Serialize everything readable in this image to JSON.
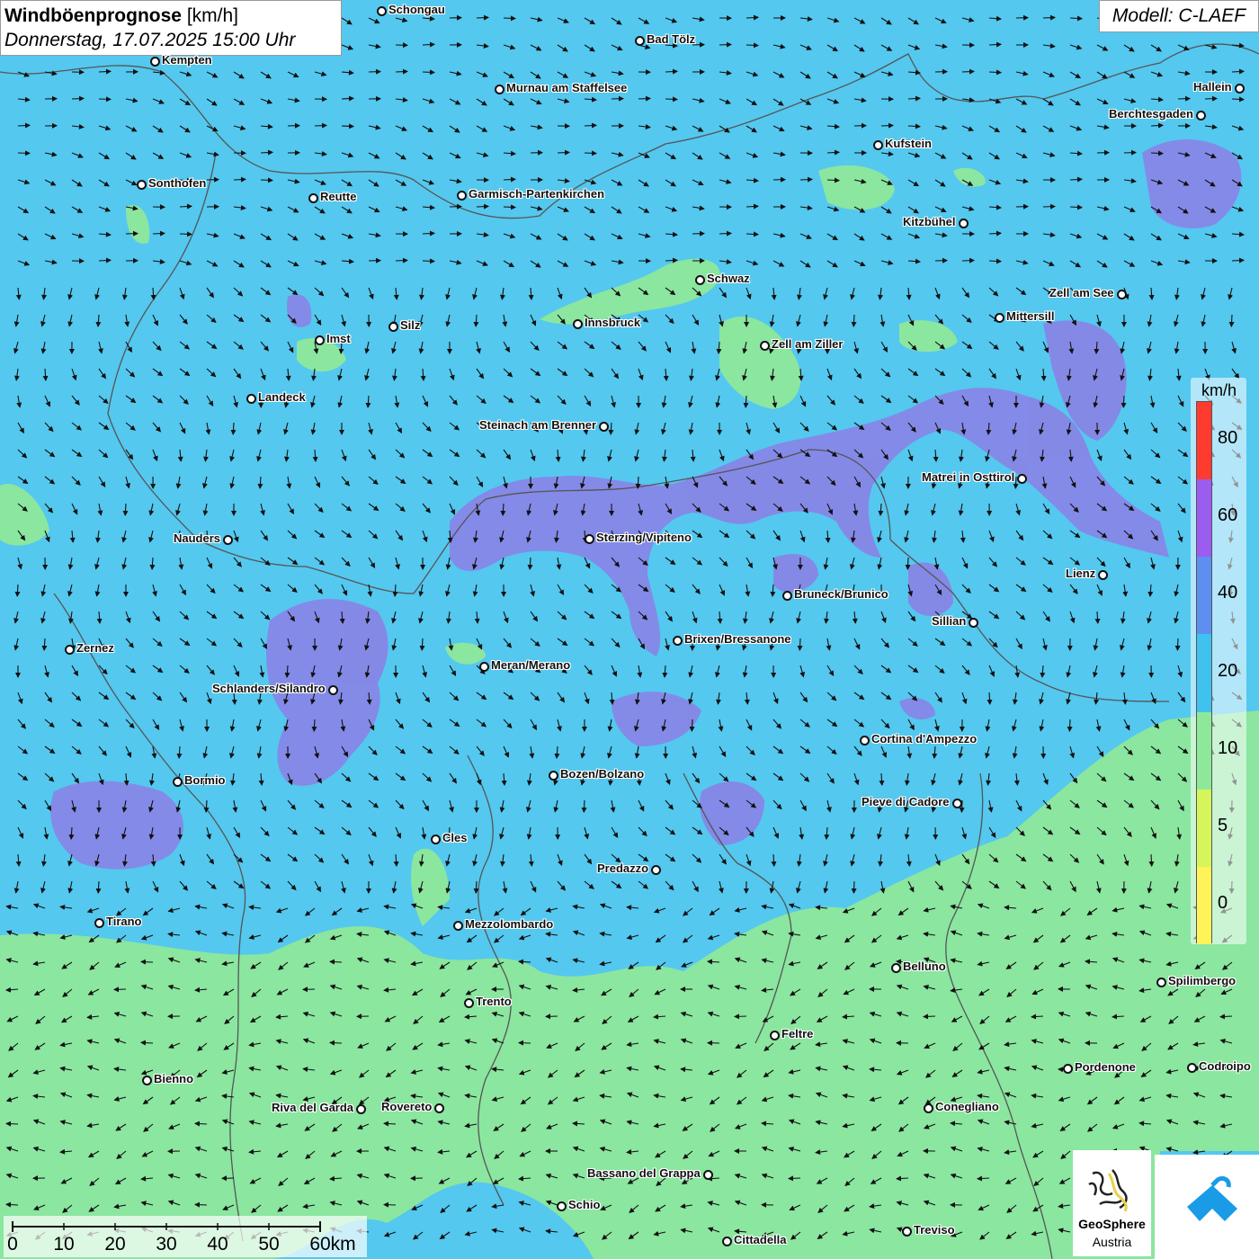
{
  "header": {
    "title_bold": "Windböenprognose",
    "title_unit": "[km/h]",
    "datetime": "Donnerstag, 17.07.2025 15:00 Uhr"
  },
  "model": {
    "label": "Modell: C-LAEF"
  },
  "legend": {
    "unit": "km/h",
    "thresholds": [
      {
        "value": "80",
        "color": "#ff3b30"
      },
      {
        "value": "60",
        "color": "#9b5cf0"
      },
      {
        "value": "40",
        "color": "#5d8ff0"
      },
      {
        "value": "20",
        "color": "#3fc2ee"
      },
      {
        "value": "10",
        "color": "#8ee89a"
      },
      {
        "value": "5",
        "color": "#d6f55a"
      },
      {
        "value": "0",
        "color": "#fff35a"
      }
    ]
  },
  "scale_bar": {
    "labels": [
      "0",
      "10",
      "20",
      "30",
      "40",
      "50",
      "60km"
    ]
  },
  "colors": {
    "calm_green": "#8ee89a",
    "wind_blue": "#54c8ef",
    "strong_purple": "#8a83e6",
    "border_gray": "#555555",
    "arrow": "#111111"
  },
  "logos": {
    "geosphere_line1": "GeoSphere",
    "geosphere_line2": "Austria",
    "icons": [
      "geosphere-logo-icon",
      "wind-app-logo-icon"
    ]
  },
  "cities": [
    {
      "name": "Schongau"
    },
    {
      "name": "Bad Tölz"
    },
    {
      "name": "Kempten"
    },
    {
      "name": "Murnau am Staffelsee"
    },
    {
      "name": "Hallein"
    },
    {
      "name": "Berchtesgaden"
    },
    {
      "name": "Kufstein"
    },
    {
      "name": "Sonthofen"
    },
    {
      "name": "Reutte"
    },
    {
      "name": "Garmisch-Partenkirchen"
    },
    {
      "name": "Kitzbühel"
    },
    {
      "name": "Schwaz"
    },
    {
      "name": "Zell am See"
    },
    {
      "name": "Mittersill"
    },
    {
      "name": "Innsbruck"
    },
    {
      "name": "Imst"
    },
    {
      "name": "Silz"
    },
    {
      "name": "Zell am Ziller"
    },
    {
      "name": "Landeck"
    },
    {
      "name": "Steinach am Brenner"
    },
    {
      "name": "Matrei in Osttirol"
    },
    {
      "name": "Nauders"
    },
    {
      "name": "Sterzing/Vipiteno"
    },
    {
      "name": "Lienz"
    },
    {
      "name": "Bruneck/Brunico"
    },
    {
      "name": "Sillian"
    },
    {
      "name": "Zernez"
    },
    {
      "name": "Brixen/Bressanone"
    },
    {
      "name": "Meran/Merano"
    },
    {
      "name": "Schlanders/Silandro"
    },
    {
      "name": "Cortina d'Ampezzo"
    },
    {
      "name": "Bozen/Bolzano"
    },
    {
      "name": "Bormio"
    },
    {
      "name": "Pieve di Cadore"
    },
    {
      "name": "Cles"
    },
    {
      "name": "Predazzo"
    },
    {
      "name": "Tirano"
    },
    {
      "name": "Mezzolombardo"
    },
    {
      "name": "Belluno"
    },
    {
      "name": "Spilimbergo"
    },
    {
      "name": "Trento"
    },
    {
      "name": "Feltre"
    },
    {
      "name": "Pordenone"
    },
    {
      "name": "Codroipo"
    },
    {
      "name": "Bienno"
    },
    {
      "name": "Riva del Garda"
    },
    {
      "name": "Rovereto"
    },
    {
      "name": "Conegliano"
    },
    {
      "name": "Bassano del Grappa"
    },
    {
      "name": "Schio"
    },
    {
      "name": "Treviso"
    },
    {
      "name": "Cittadella"
    }
  ]
}
